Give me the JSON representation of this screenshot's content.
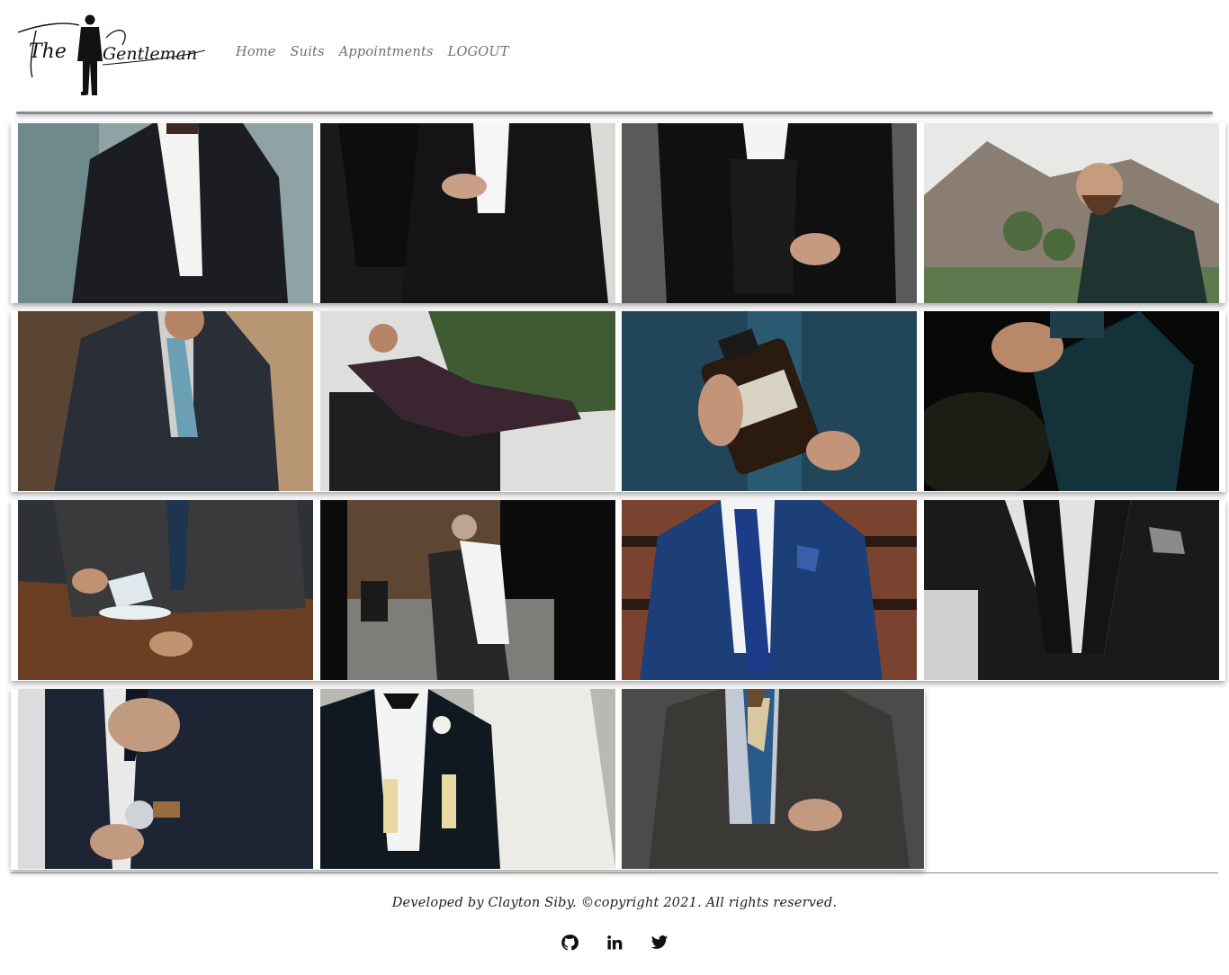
{
  "brand": {
    "logo_text_left": "The",
    "logo_text_right": "Gentleman"
  },
  "nav": {
    "items": [
      "Home",
      "Suits",
      "Appointments",
      "LOGOUT"
    ]
  },
  "gallery": {
    "tiles": [
      {
        "name": "suit-photo-1"
      },
      {
        "name": "suit-photo-2"
      },
      {
        "name": "suit-photo-3"
      },
      {
        "name": "suit-photo-4"
      },
      {
        "name": "suit-photo-5"
      },
      {
        "name": "suit-photo-6"
      },
      {
        "name": "suit-photo-7"
      },
      {
        "name": "suit-photo-8"
      },
      {
        "name": "suit-photo-9"
      },
      {
        "name": "suit-photo-10"
      },
      {
        "name": "suit-photo-11"
      },
      {
        "name": "suit-photo-12"
      },
      {
        "name": "suit-photo-13"
      },
      {
        "name": "suit-photo-14"
      },
      {
        "name": "suit-photo-15"
      }
    ]
  },
  "footer": {
    "credit": "Developed by Clayton Siby. ©copyright 2021. All rights reserved.",
    "social_icons": [
      "github-icon",
      "linkedin-icon",
      "twitter-icon"
    ]
  }
}
